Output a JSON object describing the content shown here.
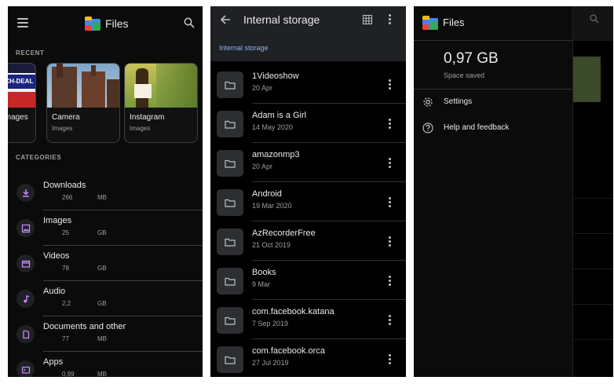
{
  "panel1": {
    "app_title": "Files",
    "recent_label": "RECENT",
    "recent": [
      {
        "title": "Images",
        "subtitle": ""
      },
      {
        "title": "Camera",
        "subtitle": "Images"
      },
      {
        "title": "Instagram",
        "subtitle": "Images"
      }
    ],
    "thumb_text": "ECH-DEAL",
    "categories_label": "CATEGORIES",
    "categories": [
      {
        "name": "Downloads",
        "size": "266",
        "unit": "MB",
        "icon": "download-icon"
      },
      {
        "name": "Images",
        "size": "25",
        "unit": "GB",
        "icon": "image-icon"
      },
      {
        "name": "Videos",
        "size": "78",
        "unit": "GB",
        "icon": "video-icon"
      },
      {
        "name": "Audio",
        "size": "2,2",
        "unit": "GB",
        "icon": "music-note-icon"
      },
      {
        "name": "Documents and other",
        "size": "77",
        "unit": "MB",
        "icon": "document-icon"
      },
      {
        "name": "Apps",
        "size": "0,99",
        "unit": "MB",
        "icon": "apps-icon"
      }
    ],
    "colors": {
      "accent": "#8ab4f8",
      "icon_purple": "#c58af9"
    }
  },
  "panel2": {
    "title": "Internal storage",
    "breadcrumb": "Internal storage",
    "folders": [
      {
        "name": "1Videoshow",
        "date": "20 Apr"
      },
      {
        "name": "Adam is a Girl",
        "date": "14 May 2020"
      },
      {
        "name": "amazonmp3",
        "date": "20 Apr"
      },
      {
        "name": "Android",
        "date": "19 Mar 2020"
      },
      {
        "name": "AzRecorderFree",
        "date": "21 Oct 2019"
      },
      {
        "name": "Books",
        "date": "9 Mar"
      },
      {
        "name": "com.facebook.katana",
        "date": "7 Sep 2019"
      },
      {
        "name": "com.facebook.orca",
        "date": "27 Jul 2019"
      }
    ]
  },
  "panel3": {
    "app_title": "Files",
    "space_value": "0,97",
    "space_unit": "GB",
    "space_label": "Space saved",
    "items": [
      {
        "label": "Settings",
        "icon": "gear-icon"
      },
      {
        "label": "Help and feedback",
        "icon": "help-icon"
      }
    ]
  }
}
